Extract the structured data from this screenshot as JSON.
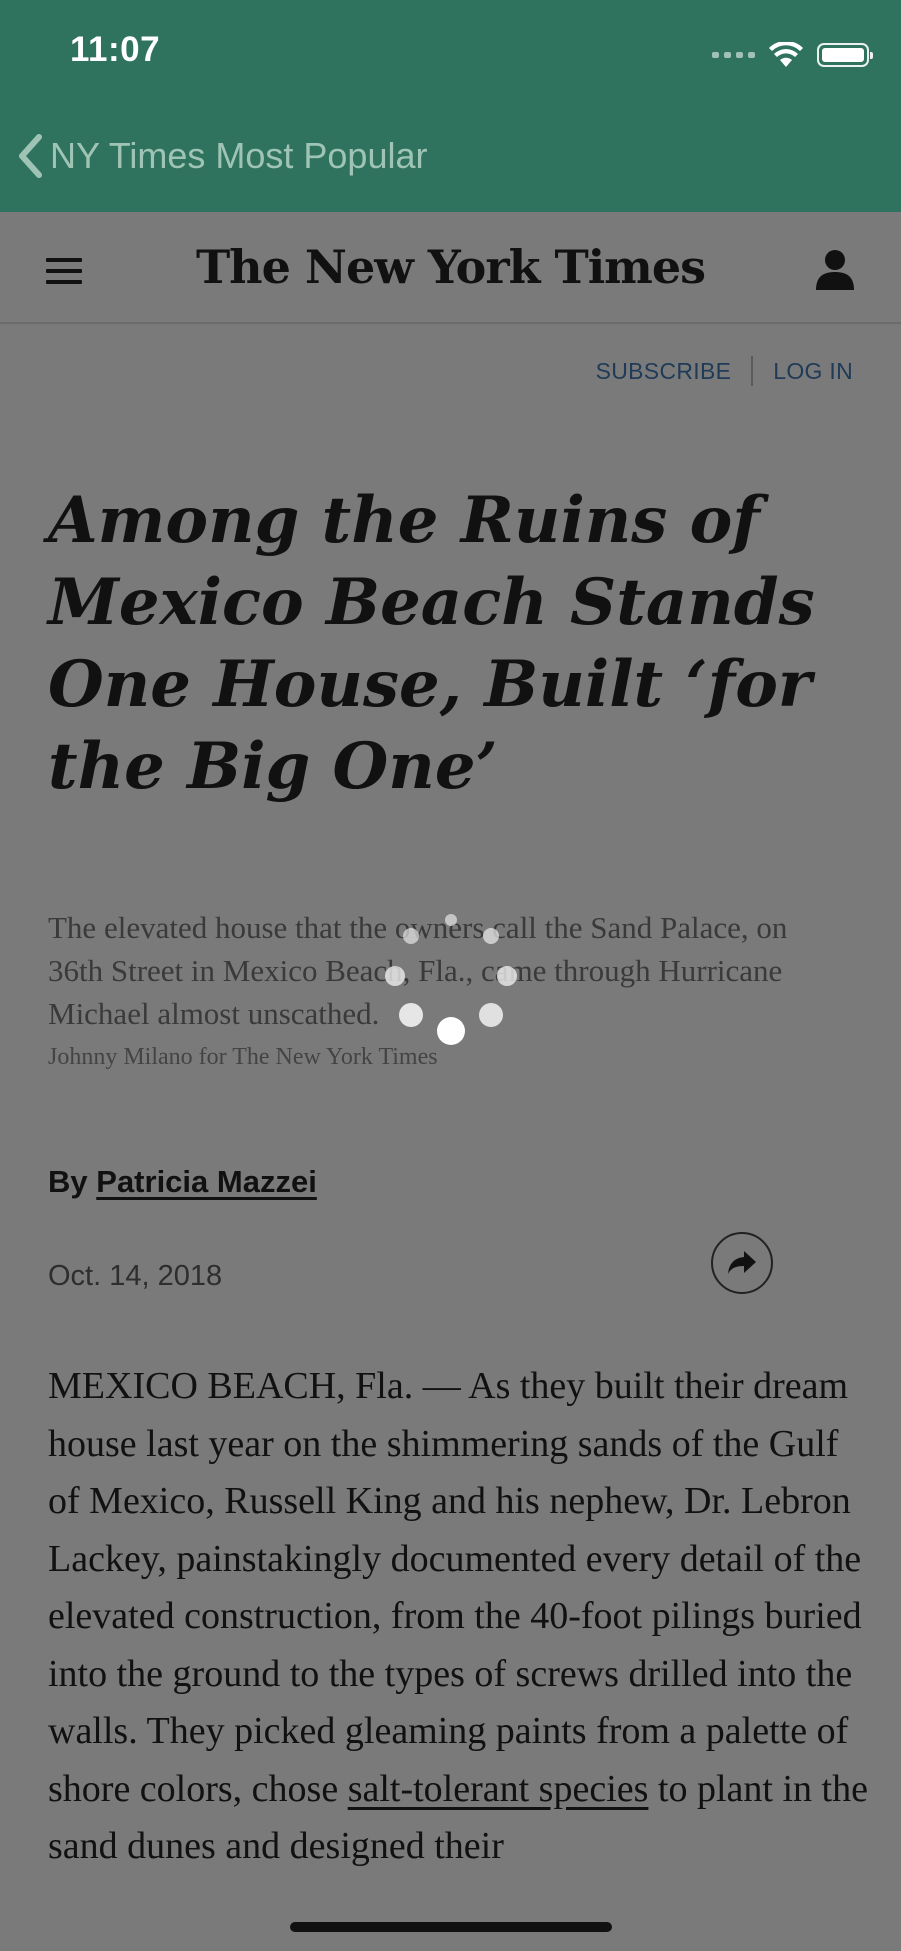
{
  "status_bar": {
    "time": "11:07",
    "icons": [
      "signal-icon",
      "wifi-icon",
      "battery-icon"
    ]
  },
  "nav": {
    "back_label": "NY Times Most Popular"
  },
  "header": {
    "logo": "The New York Times",
    "icons": [
      "menu-icon",
      "user-icon"
    ]
  },
  "links": {
    "subscribe": "SUBSCRIBE",
    "login": "LOG IN"
  },
  "article": {
    "headline": "Among the Ruins of Mexico Beach Stands One House, Built ‘for the Big One’",
    "caption": "The elevated house that the owners call the Sand Palace, on 36th Street in Mexico Beach, Fla., came through Hurricane Michael almost unscathed.",
    "credit": "Johnny Milano for The New York Times",
    "byline_prefix": "By",
    "author": "Patricia Mazzei",
    "date": "Oct. 14, 2018",
    "body_before_link": "MEXICO BEACH, Fla. — As they built their dream house last year on the shimmering sands of the Gulf of Mexico, Russell King and his nephew, Dr. Lebron Lackey, painstakingly documented every detail of the elevated construction, from the 40-foot pilings buried into the ground to the types of screws drilled into the walls. They picked gleaming paints from a palette of shore colors, chose ",
    "body_link": "salt-tolerant species",
    "body_after_link": " to plant in the sand dunes and designed their"
  },
  "colors": {
    "nav_green": "#2f735e",
    "overlay_gray": "#7a7a7a",
    "link_blue": "#1f3b57"
  }
}
